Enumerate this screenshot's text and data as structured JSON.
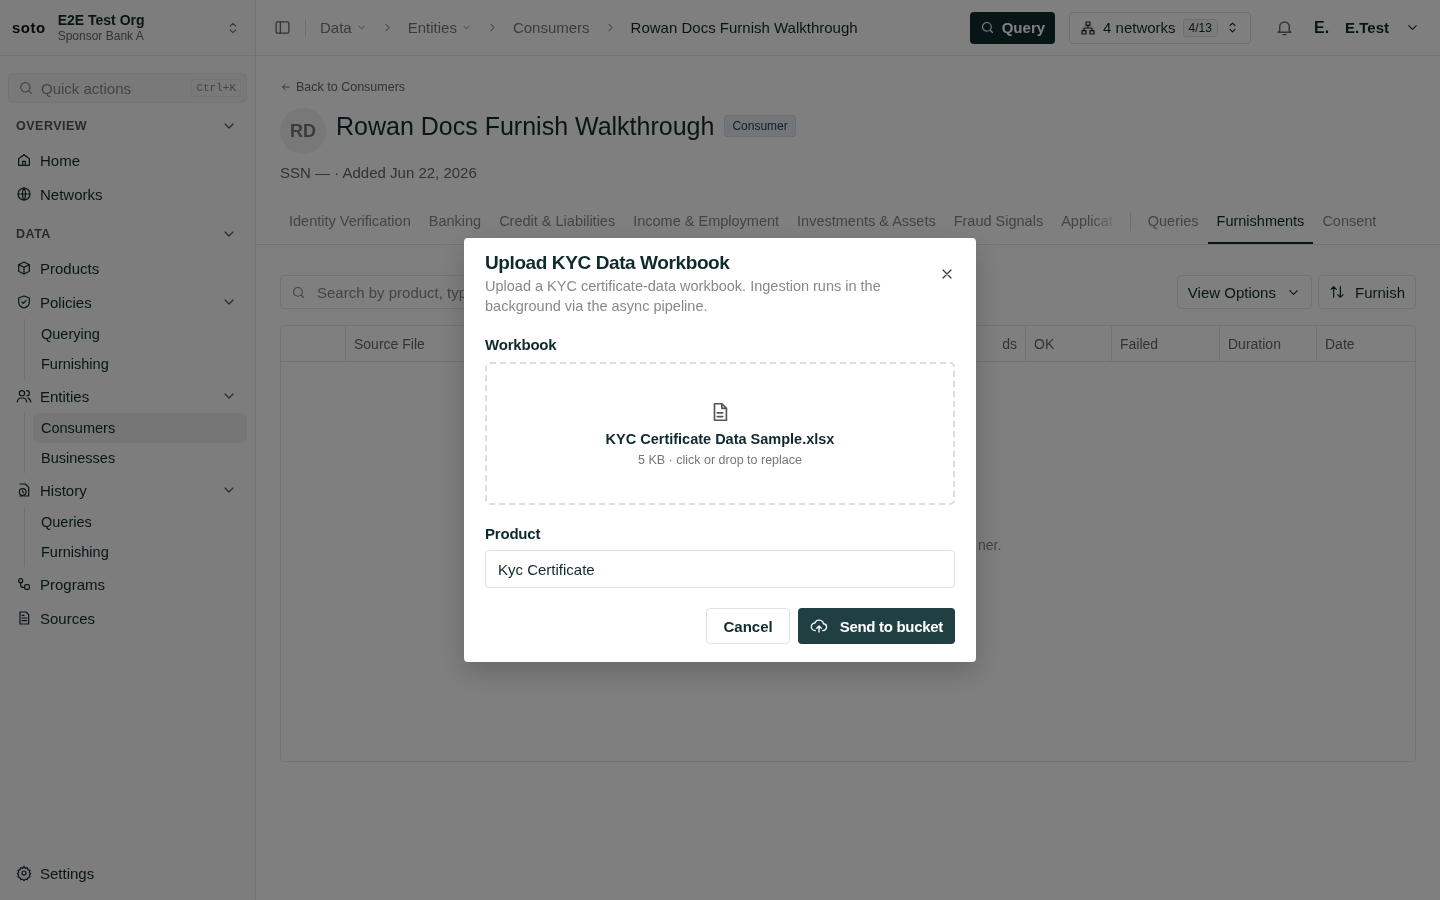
{
  "sidebar": {
    "logo": "soto",
    "org": {
      "name": "E2E Test Org",
      "subtitle": "Sponsor Bank A"
    },
    "quick_actions": {
      "placeholder": "Quick actions",
      "shortcut": "Ctrl+K"
    },
    "sections": [
      {
        "title": "OVERVIEW",
        "expanded": true,
        "items": [
          {
            "label": "Home",
            "selected": false
          },
          {
            "label": "Networks",
            "selected": false
          }
        ]
      },
      {
        "title": "DATA",
        "expanded": true,
        "items": [
          {
            "label": "Products",
            "selected": false
          },
          {
            "label": "Policies",
            "selected": false,
            "expanded": true,
            "children": [
              {
                "label": "Querying",
                "selected": false
              },
              {
                "label": "Furnishing",
                "selected": false
              }
            ]
          },
          {
            "label": "Entities",
            "selected": false,
            "expanded": true,
            "children": [
              {
                "label": "Consumers",
                "selected": true
              },
              {
                "label": "Businesses",
                "selected": false
              }
            ]
          },
          {
            "label": "History",
            "selected": false,
            "expanded": true,
            "children": [
              {
                "label": "Queries",
                "selected": false
              },
              {
                "label": "Furnishing",
                "selected": false
              }
            ]
          },
          {
            "label": "Programs",
            "selected": false
          },
          {
            "label": "Sources",
            "selected": false
          }
        ]
      }
    ],
    "settings": "Settings"
  },
  "header": {
    "breadcrumbs": [
      {
        "label": "Data",
        "dropdown": true,
        "current": false
      },
      {
        "label": "Entities",
        "dropdown": true,
        "current": false
      },
      {
        "label": "Consumers",
        "dropdown": false,
        "current": false
      },
      {
        "label": "Rowan Docs Furnish Walkthrough",
        "dropdown": false,
        "current": true
      }
    ],
    "query_button": "Query",
    "networks": {
      "label": "4 networks",
      "count": "4/13"
    },
    "user": {
      "initial": "E.",
      "name": "E.Test"
    }
  },
  "page": {
    "back_link": "Back to Consumers",
    "avatar": "RD",
    "title": "Rowan Docs Furnish Walkthrough",
    "badge": "Consumer",
    "meta": "SSN — · Added Jun 22, 2026",
    "tab_groups": [
      [
        {
          "label": "Identity Verification",
          "selected": false,
          "faded": false
        },
        {
          "label": "Banking",
          "selected": false,
          "faded": false
        },
        {
          "label": "Credit & Liabilities",
          "selected": false,
          "faded": false
        },
        {
          "label": "Income & Employment",
          "selected": false,
          "faded": false
        },
        {
          "label": "Investments & Assets",
          "selected": false,
          "faded": false
        },
        {
          "label": "Fraud Signals",
          "selected": false,
          "faded": false
        },
        {
          "label": "Applicat",
          "selected": false,
          "faded": true
        }
      ],
      [
        {
          "label": "Queries",
          "selected": false,
          "faded": false
        },
        {
          "label": "Furnishments",
          "selected": true,
          "faded": false
        },
        {
          "label": "Consent",
          "selected": false,
          "faded": false
        }
      ]
    ],
    "search": {
      "placeholder": "Search by product, typ"
    },
    "view_options": "View Options",
    "furnish_button": "Furnish",
    "table": {
      "columns": [
        "Source File",
        "ds",
        "OK",
        "Failed",
        "Duration",
        "Date"
      ],
      "empty_message": "ner."
    }
  },
  "modal": {
    "title": "Upload KYC Data Workbook",
    "description": "Upload a KYC certificate-data workbook. Ingestion runs in the background via the async pipeline.",
    "workbook_label": "Workbook",
    "file": {
      "name": "KYC Certificate Data Sample.xlsx",
      "info": "5 KB · click or drop to replace"
    },
    "product_label": "Product",
    "product_value": "Kyc Certificate",
    "cancel": "Cancel",
    "submit": "Send to bucket"
  }
}
